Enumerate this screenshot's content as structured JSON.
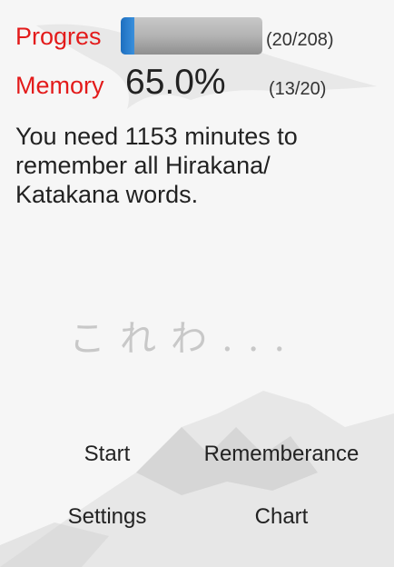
{
  "progress": {
    "label": "Progres",
    "count": "(20/208)",
    "fraction": 0.096
  },
  "memory": {
    "label": "Memory",
    "percent": "65.0%",
    "count": "(13/20)"
  },
  "info": "You need 1153 minutes to remember all Hirakana/ Katakana words.",
  "watermark": "これわ...",
  "buttons": {
    "start": "Start",
    "rememberance": "Rememberance",
    "settings": "Settings",
    "chart": "Chart"
  },
  "colors": {
    "accent": "#e31b1b",
    "progress_fill": "#2a7fd0"
  }
}
